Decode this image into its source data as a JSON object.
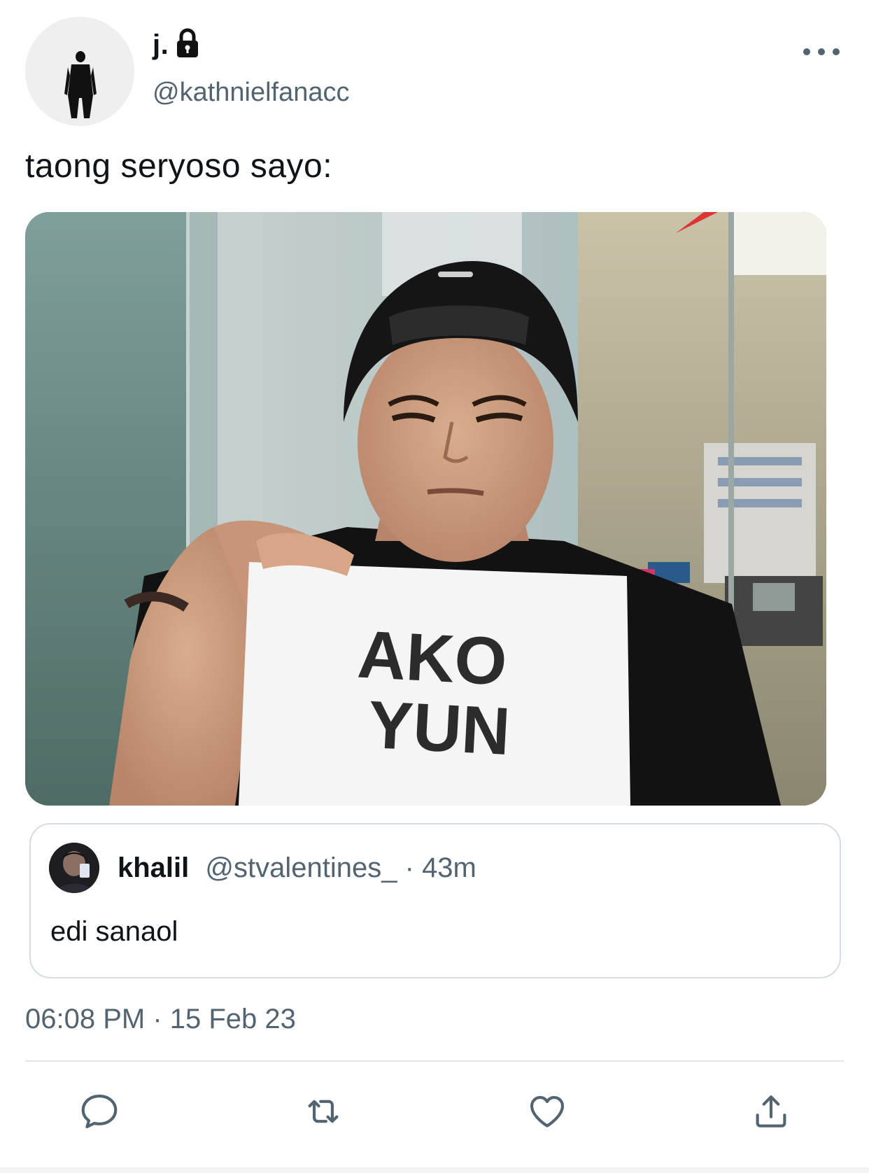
{
  "tweet": {
    "author": {
      "display_name": "j.",
      "handle": "@kathnielfanacc",
      "avatar_icon": "person-silhouette-icon",
      "protected_icon": "lock-icon"
    },
    "text": "taong seryoso sayo:",
    "media": {
      "sign_line1": "AKO",
      "sign_line2": "YUN"
    },
    "quote": {
      "display_name": "khalil",
      "handle": "@stvalentines_",
      "separator": "·",
      "time": "43m",
      "text": "edi sanaol"
    },
    "timestamp": "06:08 PM · 15 Feb 23"
  },
  "actions": {
    "reply_icon": "reply-icon",
    "retweet_icon": "retweet-icon",
    "like_icon": "heart-icon",
    "share_icon": "share-icon",
    "more_icon": "more-dots-icon"
  },
  "colors": {
    "text_primary": "#0f1419",
    "text_secondary": "#536471",
    "border": "#d6dde2"
  }
}
